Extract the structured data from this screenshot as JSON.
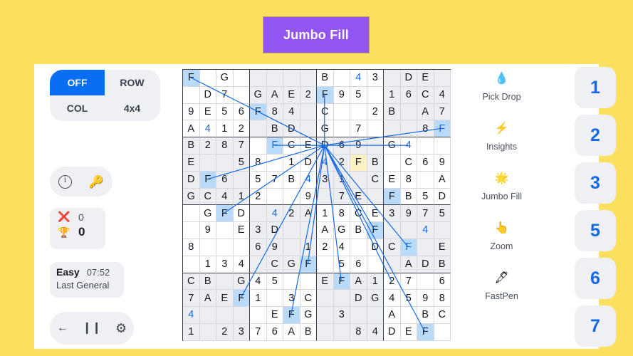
{
  "banner": {
    "title": "Jumbo Fill"
  },
  "colors": {
    "page_background": "#fbdf5e",
    "banner_background": "#9355ef",
    "accent_blue": "#0a6ef5",
    "digit_blue": "#1568e5",
    "highlight_cell": "#b9daf8",
    "selected_cell": "#fdf0c4",
    "panel_gray": "#eef0f3",
    "grid_line": "#3a3f49"
  },
  "left_panel": {
    "mode_toggle": {
      "options": [
        "OFF",
        "ROW",
        "COL",
        "4x4"
      ],
      "selected": "OFF"
    },
    "small_pill": {
      "info_icon": "info-icon",
      "key_icon": "key-icon"
    },
    "stats": {
      "mistakes_icon": "red-cross-icon",
      "mistakes": "0",
      "trophy_icon": "trophy-icon",
      "score": "0"
    },
    "game_info": {
      "difficulty": "Easy",
      "timer": "07:52",
      "mode": "Last General"
    },
    "controls": {
      "back_icon": "back-arrow-icon",
      "pause_icon": "pause-icon",
      "settings_icon": "gear-icon"
    }
  },
  "tools": [
    {
      "icon": "water-drop-icon",
      "glyph": "💧",
      "label": "Pick Drop"
    },
    {
      "icon": "lightning-bolt-icon",
      "glyph": "⚡",
      "label": "Insights"
    },
    {
      "icon": "shooting-star-icon",
      "glyph": "🌟",
      "label": "Jumbo Fill"
    },
    {
      "icon": "pointing-hand-icon",
      "glyph": "👆",
      "label": "Zoom"
    },
    {
      "icon": "fountain-pen-icon",
      "glyph": "🖋",
      "label": "FastPen"
    }
  ],
  "numpad": [
    "1",
    "2",
    "3",
    "5",
    "6",
    "7"
  ],
  "grid": {
    "size": 16,
    "box": 4,
    "selected_cell": {
      "row": 5,
      "col": 9
    },
    "rows": [
      [
        {
          "v": "F",
          "s": "hl"
        },
        {
          "v": ""
        },
        {
          "v": "G"
        },
        {
          "v": ""
        },
        {
          "v": "",
          "s": "shade"
        },
        {
          "v": "",
          "s": "shade"
        },
        {
          "v": "",
          "s": "shade"
        },
        {
          "v": "",
          "s": "shade"
        },
        {
          "v": "B"
        },
        {
          "v": ""
        },
        {
          "v": "4",
          "c": "blu"
        },
        {
          "v": "3"
        },
        {
          "v": "",
          "s": "shade"
        },
        {
          "v": "D",
          "s": "shade"
        },
        {
          "v": "E",
          "s": "shade"
        },
        {
          "v": "",
          "s": "shade"
        }
      ],
      [
        {
          "v": ""
        },
        {
          "v": "D"
        },
        {
          "v": "7"
        },
        {
          "v": ""
        },
        {
          "v": "G",
          "s": "shade"
        },
        {
          "v": "A",
          "s": "shade"
        },
        {
          "v": "E",
          "s": "shade"
        },
        {
          "v": "2",
          "s": "shade"
        },
        {
          "v": "F",
          "s": "hl"
        },
        {
          "v": "9"
        },
        {
          "v": "5"
        },
        {
          "v": ""
        },
        {
          "v": "1",
          "s": "shade"
        },
        {
          "v": "6",
          "s": "shade"
        },
        {
          "v": "C",
          "s": "shade"
        },
        {
          "v": "4",
          "s": "shade"
        }
      ],
      [
        {
          "v": "9"
        },
        {
          "v": "E"
        },
        {
          "v": "5"
        },
        {
          "v": "6"
        },
        {
          "v": "F",
          "s": "hl"
        },
        {
          "v": "8",
          "s": "shade"
        },
        {
          "v": "4",
          "s": "shade"
        },
        {
          "v": "",
          "s": "shade"
        },
        {
          "v": "C"
        },
        {
          "v": ""
        },
        {
          "v": ""
        },
        {
          "v": "2"
        },
        {
          "v": "B",
          "s": "shade"
        },
        {
          "v": "",
          "s": "shade"
        },
        {
          "v": "A",
          "s": "shade"
        },
        {
          "v": "7",
          "s": "shade"
        }
      ],
      [
        {
          "v": "A"
        },
        {
          "v": "4",
          "c": "blu"
        },
        {
          "v": "1"
        },
        {
          "v": "2"
        },
        {
          "v": "",
          "s": "shade"
        },
        {
          "v": "B",
          "s": "shade"
        },
        {
          "v": "D",
          "s": "shade"
        },
        {
          "v": "",
          "s": "shade"
        },
        {
          "v": "G"
        },
        {
          "v": ""
        },
        {
          "v": "7"
        },
        {
          "v": ""
        },
        {
          "v": "",
          "s": "shade"
        },
        {
          "v": "",
          "s": "shade"
        },
        {
          "v": "8",
          "s": "shade"
        },
        {
          "v": "F",
          "s": "hl",
          "c": "blu"
        }
      ],
      [
        {
          "v": "B",
          "s": "shade"
        },
        {
          "v": "2",
          "s": "shade"
        },
        {
          "v": "8",
          "s": "shade"
        },
        {
          "v": "7",
          "s": "shade"
        },
        {
          "v": ""
        },
        {
          "v": "F",
          "s": "hl",
          "c": "blu"
        },
        {
          "v": "C"
        },
        {
          "v": "E"
        },
        {
          "v": "D",
          "s": "shade"
        },
        {
          "v": "6",
          "s": "shade"
        },
        {
          "v": "9",
          "s": "shade"
        },
        {
          "v": "",
          "s": "shade"
        },
        {
          "v": "G"
        },
        {
          "v": "4",
          "c": "blu"
        },
        {
          "v": ""
        },
        {
          "v": ""
        }
      ],
      [
        {
          "v": "E",
          "s": "shade"
        },
        {
          "v": "",
          "s": "shade"
        },
        {
          "v": "",
          "s": "shade"
        },
        {
          "v": "5",
          "s": "shade"
        },
        {
          "v": "8"
        },
        {
          "v": ""
        },
        {
          "v": "1"
        },
        {
          "v": "D"
        },
        {
          "v": "4",
          "s": "shade",
          "c": "blu"
        },
        {
          "v": "2",
          "s": "shade"
        },
        {
          "v": "F",
          "s": "sel"
        },
        {
          "v": "B",
          "s": "shade"
        },
        {
          "v": ""
        },
        {
          "v": "C"
        },
        {
          "v": "6"
        },
        {
          "v": "9"
        }
      ],
      [
        {
          "v": "D",
          "s": "shade"
        },
        {
          "v": "F",
          "s": "hl"
        },
        {
          "v": "6",
          "s": "shade"
        },
        {
          "v": "",
          "s": "shade"
        },
        {
          "v": "5"
        },
        {
          "v": "7"
        },
        {
          "v": "B"
        },
        {
          "v": "4",
          "c": "blu"
        },
        {
          "v": "3",
          "s": "shade"
        },
        {
          "v": "1",
          "s": "shade"
        },
        {
          "v": "",
          "s": "shade"
        },
        {
          "v": "C",
          "s": "shade"
        },
        {
          "v": "E"
        },
        {
          "v": "8"
        },
        {
          "v": ""
        },
        {
          "v": "A"
        }
      ],
      [
        {
          "v": "G",
          "s": "shade"
        },
        {
          "v": "C",
          "s": "shade"
        },
        {
          "v": "4",
          "s": "shade"
        },
        {
          "v": "1",
          "s": "shade"
        },
        {
          "v": "2"
        },
        {
          "v": ""
        },
        {
          "v": ""
        },
        {
          "v": "9"
        },
        {
          "v": "",
          "s": "shade"
        },
        {
          "v": "7",
          "s": "shade"
        },
        {
          "v": "E",
          "s": "shade"
        },
        {
          "v": "",
          "s": "shade"
        },
        {
          "v": "F",
          "s": "hl"
        },
        {
          "v": "B"
        },
        {
          "v": "5"
        },
        {
          "v": "D"
        }
      ],
      [
        {
          "v": ""
        },
        {
          "v": "G"
        },
        {
          "v": "F",
          "s": "hl"
        },
        {
          "v": "D"
        },
        {
          "v": "",
          "s": "shade"
        },
        {
          "v": "4",
          "s": "shade",
          "c": "blu"
        },
        {
          "v": "2",
          "s": "shade"
        },
        {
          "v": "A",
          "s": "shade"
        },
        {
          "v": "1"
        },
        {
          "v": "8"
        },
        {
          "v": "C"
        },
        {
          "v": "E"
        },
        {
          "v": "3",
          "s": "shade"
        },
        {
          "v": "9",
          "s": "shade"
        },
        {
          "v": "7",
          "s": "shade"
        },
        {
          "v": "5",
          "s": "shade"
        }
      ],
      [
        {
          "v": ""
        },
        {
          "v": "9"
        },
        {
          "v": ""
        },
        {
          "v": "E"
        },
        {
          "v": "3",
          "s": "shade"
        },
        {
          "v": "D",
          "s": "shade"
        },
        {
          "v": "",
          "s": "shade"
        },
        {
          "v": "",
          "s": "shade"
        },
        {
          "v": "A"
        },
        {
          "v": "G"
        },
        {
          "v": "B"
        },
        {
          "v": "F",
          "s": "hl"
        },
        {
          "v": "",
          "s": "shade"
        },
        {
          "v": "",
          "s": "shade"
        },
        {
          "v": "4",
          "s": "shade",
          "c": "blu"
        },
        {
          "v": "",
          "s": "shade"
        }
      ],
      [
        {
          "v": "8"
        },
        {
          "v": ""
        },
        {
          "v": ""
        },
        {
          "v": ""
        },
        {
          "v": "6",
          "s": "shade"
        },
        {
          "v": "9",
          "s": "shade"
        },
        {
          "v": "",
          "s": "shade"
        },
        {
          "v": "1",
          "s": "shade"
        },
        {
          "v": "2"
        },
        {
          "v": "4"
        },
        {
          "v": ""
        },
        {
          "v": "D"
        },
        {
          "v": "C",
          "s": "shade"
        },
        {
          "v": "F",
          "s": "hl",
          "c": "blu"
        },
        {
          "v": "",
          "s": "shade"
        },
        {
          "v": "E",
          "s": "shade"
        }
      ],
      [
        {
          "v": ""
        },
        {
          "v": "1"
        },
        {
          "v": "3"
        },
        {
          "v": "4"
        },
        {
          "v": "",
          "s": "shade"
        },
        {
          "v": "C",
          "s": "shade"
        },
        {
          "v": "G",
          "s": "shade"
        },
        {
          "v": "F",
          "s": "hl"
        },
        {
          "v": ""
        },
        {
          "v": "5"
        },
        {
          "v": "6"
        },
        {
          "v": ""
        },
        {
          "v": "",
          "s": "shade"
        },
        {
          "v": "A",
          "s": "shade"
        },
        {
          "v": "D",
          "s": "shade"
        },
        {
          "v": "B",
          "s": "shade"
        }
      ],
      [
        {
          "v": "C",
          "s": "shade"
        },
        {
          "v": "B",
          "s": "shade"
        },
        {
          "v": "",
          "s": "shade"
        },
        {
          "v": "G",
          "s": "shade"
        },
        {
          "v": "4"
        },
        {
          "v": "5"
        },
        {
          "v": ""
        },
        {
          "v": ""
        },
        {
          "v": "E",
          "s": "shade"
        },
        {
          "v": "F",
          "s": "hl"
        },
        {
          "v": "A",
          "s": "shade"
        },
        {
          "v": "1",
          "s": "shade"
        },
        {
          "v": "2"
        },
        {
          "v": "7"
        },
        {
          "v": ""
        },
        {
          "v": "6"
        }
      ],
      [
        {
          "v": "7",
          "s": "shade"
        },
        {
          "v": "A",
          "s": "shade"
        },
        {
          "v": "E",
          "s": "shade"
        },
        {
          "v": "F",
          "s": "hl"
        },
        {
          "v": "1"
        },
        {
          "v": ""
        },
        {
          "v": "3"
        },
        {
          "v": "C"
        },
        {
          "v": "",
          "s": "shade"
        },
        {
          "v": "",
          "s": "shade"
        },
        {
          "v": "D",
          "s": "shade"
        },
        {
          "v": "G",
          "s": "shade"
        },
        {
          "v": "4"
        },
        {
          "v": "5"
        },
        {
          "v": "9"
        },
        {
          "v": "8"
        }
      ],
      [
        {
          "v": "4",
          "s": "shade",
          "c": "blu"
        },
        {
          "v": "",
          "s": "shade"
        },
        {
          "v": "",
          "s": "shade"
        },
        {
          "v": "",
          "s": "shade"
        },
        {
          "v": ""
        },
        {
          "v": "E"
        },
        {
          "v": "F",
          "s": "hl"
        },
        {
          "v": "G"
        },
        {
          "v": "",
          "s": "shade"
        },
        {
          "v": "3",
          "s": "shade"
        },
        {
          "v": "",
          "s": "shade"
        },
        {
          "v": "",
          "s": "shade"
        },
        {
          "v": "A"
        },
        {
          "v": ""
        },
        {
          "v": "B"
        },
        {
          "v": "C"
        }
      ],
      [
        {
          "v": "1",
          "s": "shade"
        },
        {
          "v": "",
          "s": "shade"
        },
        {
          "v": "2",
          "s": "shade"
        },
        {
          "v": "3",
          "s": "shade"
        },
        {
          "v": "7"
        },
        {
          "v": "6"
        },
        {
          "v": "A"
        },
        {
          "v": "B"
        },
        {
          "v": "",
          "s": "shade"
        },
        {
          "v": "",
          "s": "shade"
        },
        {
          "v": "8",
          "s": "shade"
        },
        {
          "v": "4",
          "s": "shade"
        },
        {
          "v": "D"
        },
        {
          "v": "E"
        },
        {
          "v": "F",
          "s": "hl"
        },
        {
          "v": ""
        }
      ]
    ],
    "connector_lines": [
      [
        0,
        0
      ],
      [
        8,
        1
      ],
      [
        4,
        2
      ],
      [
        15,
        3
      ],
      [
        5,
        4
      ],
      [
        13,
        4
      ],
      [
        1,
        6
      ],
      [
        2,
        8
      ],
      [
        11,
        9
      ],
      [
        13,
        10
      ],
      [
        7,
        11
      ],
      [
        3,
        13
      ],
      [
        6,
        14
      ],
      [
        14,
        15
      ],
      [
        12,
        12
      ],
      [
        9,
        12
      ]
    ]
  }
}
